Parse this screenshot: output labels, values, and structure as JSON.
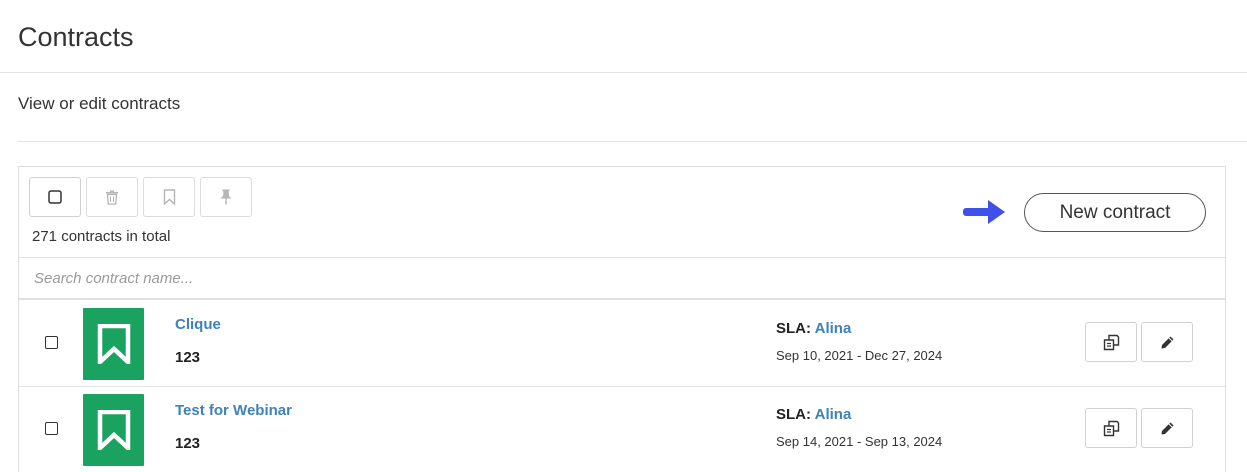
{
  "header": {
    "title": "Contracts",
    "subtitle": "View or edit contracts"
  },
  "toolbar": {
    "buttons": [
      {
        "name": "select-all",
        "icon": "checkbox-icon"
      },
      {
        "name": "delete",
        "icon": "trash-icon"
      },
      {
        "name": "bookmark",
        "icon": "bookmark-icon"
      },
      {
        "name": "pin",
        "icon": "pin-icon"
      }
    ],
    "total_count": "271 contracts in total",
    "new_button_label": "New contract",
    "arrow_color": "#3f51e8"
  },
  "search": {
    "placeholder": "Search contract name..."
  },
  "contracts": [
    {
      "name": "Clique",
      "id": "123",
      "sla_label": "SLA:",
      "sla_name": "Alina",
      "dates": "Sep 10, 2021 - Dec 27, 2024"
    },
    {
      "name": "Test for Webinar",
      "id": "123",
      "sla_label": "SLA:",
      "sla_name": "Alina",
      "dates": "Sep 14, 2021 - Sep 13, 2024"
    }
  ],
  "colors": {
    "icon_bg": "#1aa260",
    "link": "#3e82b8",
    "arrow": "#3f51e8"
  }
}
